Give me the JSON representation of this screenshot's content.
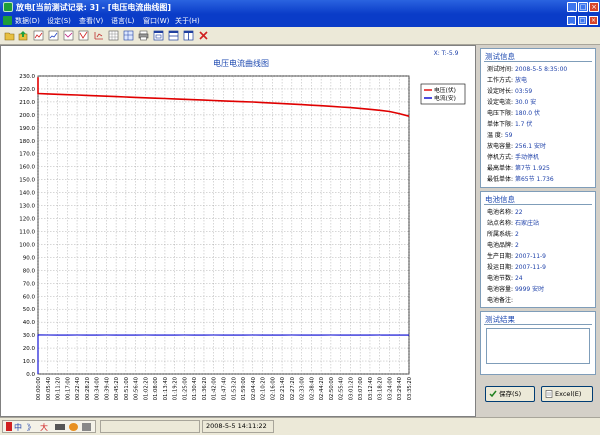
{
  "window": {
    "title": "放电[当前测试记录: 3] - [电压电流曲线图]",
    "minimize": "_",
    "maximize": "□",
    "close": "×"
  },
  "menu": {
    "items": [
      "数据(D)",
      "设定(S)",
      "查看(V)",
      "语言(L)",
      "窗口(W)",
      "关于(H)"
    ]
  },
  "toolbar": {
    "icons": [
      "open-folder-icon",
      "export-icon",
      "report-icon",
      "report2-icon",
      "report3-icon",
      "curve-icon",
      "table-icon",
      "chart-icon",
      "print-icon",
      "window-tile-icon",
      "window-h-icon",
      "window-v-icon",
      "close-red-icon"
    ]
  },
  "chart_data": {
    "type": "line",
    "title": "电压电流曲线图",
    "corner_label": "X: T:-5.9",
    "ylim": [
      0,
      230
    ],
    "yticks": [
      "230.0",
      "220.0",
      "210.0",
      "200.0",
      "190.0",
      "180.0",
      "170.0",
      "160.0",
      "150.0",
      "140.0",
      "130.0",
      "120.0",
      "110.0",
      "100.0",
      "90.0",
      "80.0",
      "70.0",
      "60.0",
      "50.0",
      "40.0",
      "30.0",
      "20.0",
      "10.0",
      "0.0"
    ],
    "x": [
      "00:00:00",
      "00:05:40",
      "00:11:20",
      "00:17:00",
      "00:22:40",
      "00:28:20",
      "00:34:00",
      "00:39:40",
      "00:45:20",
      "00:51:00",
      "00:56:40",
      "01:02:20",
      "01:08:00",
      "01:13:40",
      "01:19:20",
      "01:25:00",
      "01:30:40",
      "01:36:20",
      "01:42:00",
      "01:47:40",
      "01:53:20",
      "01:59:00",
      "02:04:40",
      "02:10:20",
      "02:16:00",
      "02:21:40",
      "02:27:20",
      "02:33:00",
      "02:38:40",
      "02:44:20",
      "02:50:00",
      "02:55:40",
      "03:01:20",
      "03:07:00",
      "03:12:40",
      "03:18:20",
      "03:24:00",
      "03:29:40",
      "03:35:20"
    ],
    "xticks": [
      "00:00:00",
      "00:05:40",
      "00:11:20",
      "00:17:00",
      "00:22:40",
      "00:28:20",
      "00:34:00",
      "00:39:40",
      "00:45:20",
      "00:51:00",
      "00:56:40",
      "01:02:20",
      "01:08:00",
      "01:13:40",
      "01:19:20",
      "01:25:00",
      "01:30:40",
      "01:36:20",
      "01:42:00",
      "01:47:40",
      "01:53:20",
      "01:59:00",
      "02:04:40",
      "02:10:20",
      "02:16:00",
      "02:21:40",
      "02:27:20",
      "02:33:00",
      "02:38:40",
      "02:44:20",
      "02:50:00",
      "02:55:40",
      "03:01:20",
      "03:07:00",
      "03:12:40",
      "03:18:20",
      "03:24:00",
      "03:29:40",
      "03:35:20"
    ],
    "series": [
      {
        "name": "电压(伏)",
        "color": "#e00000",
        "values": [
          216.5,
          216.2,
          215.9,
          215.6,
          215.3,
          215.0,
          214.7,
          214.4,
          214.1,
          213.8,
          213.5,
          213.2,
          212.9,
          212.6,
          212.3,
          212.0,
          211.7,
          211.4,
          211.1,
          210.8,
          210.5,
          210.2,
          209.9,
          209.5,
          209.1,
          208.7,
          208.3,
          207.9,
          207.5,
          207.1,
          206.6,
          206.1,
          205.6,
          205.0,
          204.3,
          203.5,
          202.6,
          201.0,
          199.0
        ]
      },
      {
        "name": "电流(安)",
        "color": "#0000d0",
        "values": [
          30.2,
          30.1,
          30.0,
          30.0,
          30.1,
          30.0,
          30.0,
          30.1,
          30.0,
          30.0,
          30.0,
          30.1,
          30.0,
          30.0,
          30.0,
          30.1,
          30.0,
          30.0,
          30.1,
          30.0,
          30.0,
          30.0,
          30.1,
          30.0,
          30.0,
          30.0,
          30.1,
          30.0,
          30.0,
          30.0,
          30.1,
          30.0,
          30.0,
          30.0,
          30.0,
          30.1,
          30.0,
          30.0,
          30.0
        ]
      }
    ],
    "start_spike": {
      "voltage_peak": 229.0,
      "current_peak": 0.0
    },
    "grid": true,
    "legend": "top-right"
  },
  "test_info": {
    "title": "测试信息",
    "rows": [
      {
        "label": "测试时间:",
        "value": "2008-5-5 8:35:00"
      },
      {
        "label": "工作方式:",
        "value": "放电"
      },
      {
        "label": "设定时长:",
        "value": "03:59"
      },
      {
        "label": "设定电流:",
        "value": "30.0 安"
      },
      {
        "label": "电压下限:",
        "value": "180.0 伏"
      },
      {
        "label": "单体下限:",
        "value": "1.7 伏"
      },
      {
        "label": "温    度:",
        "value": "59"
      },
      {
        "label": "放电容量:",
        "value": "256.1 安时"
      },
      {
        "label": "停机方式:",
        "value": "手动停机"
      },
      {
        "label": "最高单体:",
        "value": "第7节 1.925"
      },
      {
        "label": "最低单体:",
        "value": "第65节 1.736"
      }
    ]
  },
  "battery_info": {
    "title": "电池信息",
    "rows": [
      {
        "label": "电池名称:",
        "value": "22"
      },
      {
        "label": "站点名称:",
        "value": "石家庄站"
      },
      {
        "label": "所属系统:",
        "value": "2"
      },
      {
        "label": "电池品牌:",
        "value": "2"
      },
      {
        "label": "生产日期:",
        "value": "2007-11-9"
      },
      {
        "label": "投运日期:",
        "value": "2007-11-9"
      },
      {
        "label": "电池节数:",
        "value": "24"
      },
      {
        "label": "电池容量:",
        "value": "9999 安时"
      },
      {
        "label": "电池备注:",
        "value": ""
      }
    ]
  },
  "test_result": {
    "title": "测试结果",
    "value": ""
  },
  "buttons": {
    "save": "保存(S)",
    "excel": "Excel(E)"
  },
  "status": {
    "ime": [
      "中",
      "》",
      "大"
    ],
    "datetime": "2008-5-5 14:11:22"
  }
}
